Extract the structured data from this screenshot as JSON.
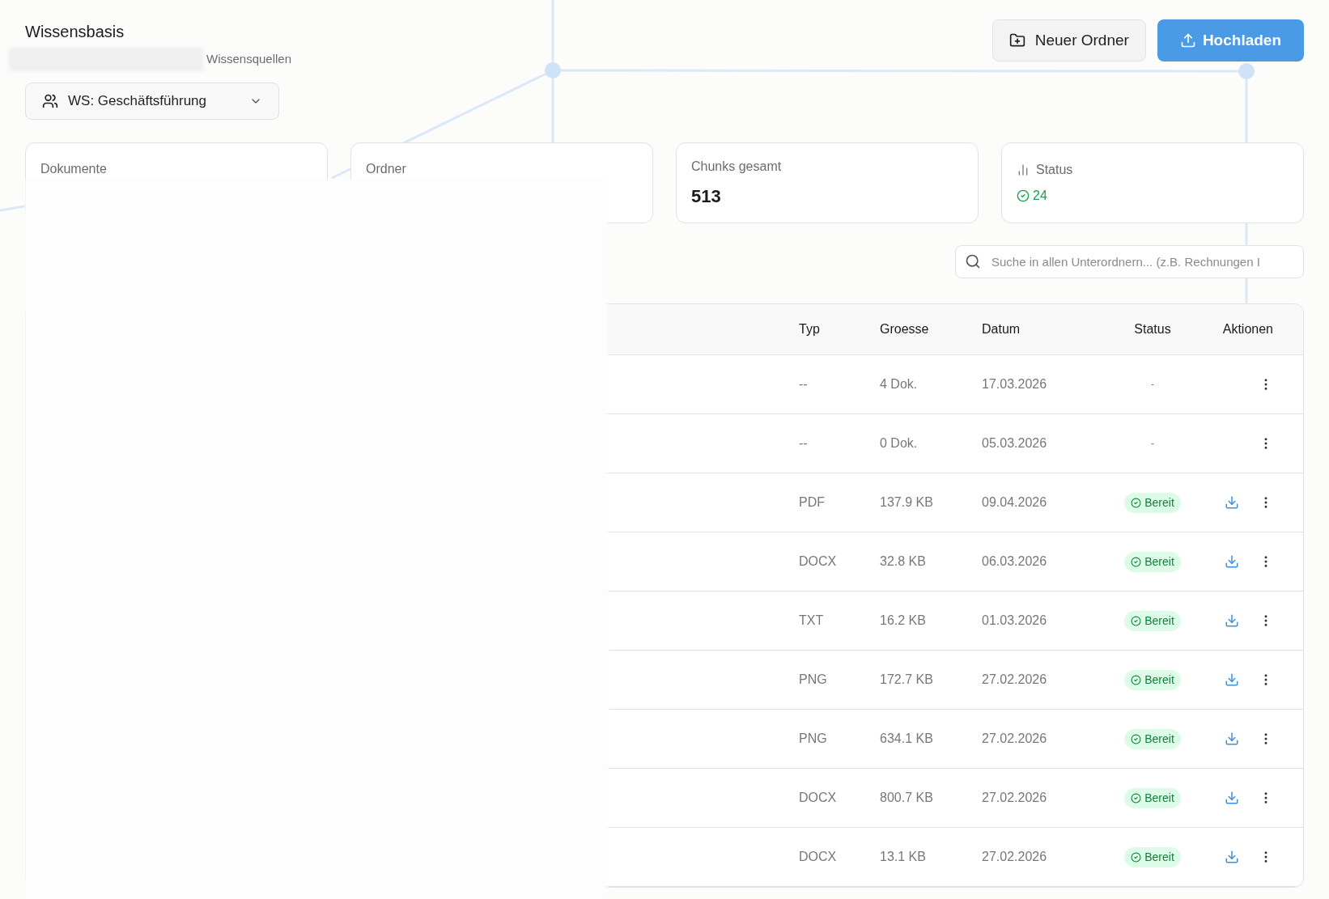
{
  "header": {
    "title": "Wissensbasis",
    "subtitle": "Wissensquellen"
  },
  "buttons": [
    {
      "kind": "secondary",
      "label": "Neuer Ordner"
    },
    {
      "kind": "primary",
      "label": "Hochladen"
    }
  ],
  "workspace_select": {
    "value": "WS: Geschäftsführung"
  },
  "stats": [
    {
      "kind": "plain",
      "label": "Dokumente"
    },
    {
      "kind": "plain",
      "label": "Ordner"
    },
    {
      "kind": "value",
      "label": "Chunks gesamt",
      "value": "513"
    },
    {
      "kind": "status",
      "label": "Status",
      "value": "24"
    }
  ],
  "search": {
    "placeholder": "Suche in allen Unterordnern... (z.B. Rechnungen I"
  },
  "table": {
    "columns": [
      "Typ",
      "Groesse",
      "Datum",
      "Status",
      "Aktionen"
    ],
    "rows": [
      {
        "kind": "folder",
        "type": "--",
        "size": "4 Dok.",
        "date": "17.03.2026",
        "status": "-"
      },
      {
        "kind": "folder",
        "type": "--",
        "size": "0 Dok.",
        "date": "05.03.2026",
        "status": "-"
      },
      {
        "kind": "file",
        "type": "PDF",
        "size": "137.9 KB",
        "date": "09.04.2026",
        "status": "Bereit"
      },
      {
        "kind": "file",
        "type": "DOCX",
        "size": "32.8 KB",
        "date": "06.03.2026",
        "status": "Bereit"
      },
      {
        "kind": "file",
        "type": "TXT",
        "size": "16.2 KB",
        "date": "01.03.2026",
        "status": "Bereit"
      },
      {
        "kind": "file",
        "type": "PNG",
        "size": "172.7 KB",
        "date": "27.02.2026",
        "status": "Bereit"
      },
      {
        "kind": "file",
        "type": "PNG",
        "size": "634.1 KB",
        "date": "27.02.2026",
        "status": "Bereit"
      },
      {
        "kind": "file",
        "type": "DOCX",
        "size": "800.7 KB",
        "date": "27.02.2026",
        "status": "Bereit"
      },
      {
        "kind": "file",
        "type": "DOCX",
        "size": "13.1 KB",
        "date": "27.02.2026",
        "status": "Bereit"
      }
    ]
  }
}
